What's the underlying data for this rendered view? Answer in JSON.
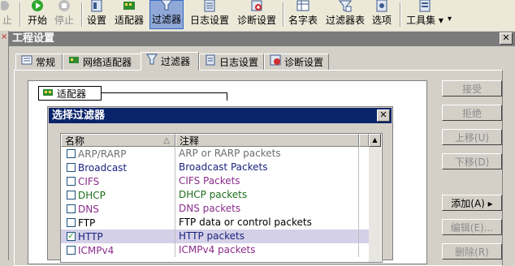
{
  "toolbar": {
    "buttons": [
      {
        "label": "止",
        "icon": "stop-icon",
        "disabled": true
      },
      {
        "label": "开始",
        "icon": "play-icon",
        "disabled": false
      },
      {
        "label": "停止",
        "icon": "stop-icon",
        "disabled": true
      },
      {
        "label": "设置",
        "icon": "settings-icon",
        "disabled": false
      },
      {
        "label": "适配器",
        "icon": "adapter-icon",
        "disabled": false
      },
      {
        "label": "过滤器",
        "icon": "filter-icon",
        "disabled": false,
        "active": true
      },
      {
        "label": "日志设置",
        "icon": "log-icon",
        "disabled": false
      },
      {
        "label": "诊断设置",
        "icon": "diagnose-icon",
        "disabled": false
      },
      {
        "label": "名字表",
        "icon": "name-table-icon",
        "disabled": false
      },
      {
        "label": "过滤器表",
        "icon": "filter-table-icon",
        "disabled": false
      },
      {
        "label": "选项",
        "icon": "options-icon",
        "disabled": false
      },
      {
        "label": "工具集",
        "icon": "toolset-icon",
        "disabled": false
      }
    ],
    "toolset_arrow": "▾"
  },
  "project_window": {
    "title": "工程设置",
    "close_label": "✕",
    "tabs": [
      {
        "label": "常规",
        "icon": "general-icon"
      },
      {
        "label": "网络适配器",
        "icon": "adapter-icon"
      },
      {
        "label": "过滤器",
        "icon": "filter-icon",
        "active": true
      },
      {
        "label": "日志设置",
        "icon": "log-icon"
      },
      {
        "label": "诊断设置",
        "icon": "diagnose-icon"
      }
    ],
    "adapter_node_label": "适配器",
    "side_buttons": [
      {
        "label": "接受",
        "enabled": false
      },
      {
        "label": "拒绝",
        "enabled": false
      },
      {
        "label": "上移(U)",
        "enabled": false
      },
      {
        "label": "下移(D)",
        "enabled": false
      },
      {
        "label": "添加(A) ▸",
        "enabled": true
      },
      {
        "label": "编辑(E)...",
        "enabled": false
      },
      {
        "label": "删除(R)",
        "enabled": false
      }
    ]
  },
  "dialog": {
    "title": "选择过滤器",
    "close_label": "✕",
    "columns": [
      "名称",
      "注释"
    ],
    "sort_indicator": "△",
    "rows": [
      {
        "name": "ARP/RARP",
        "comment": "ARP or RARP packets",
        "checked": false,
        "color": "#6e6e6e"
      },
      {
        "name": "Broadcast",
        "comment": "Broadcast Packets",
        "checked": false,
        "color": "#1a237e"
      },
      {
        "name": "CIFS",
        "comment": "CIFS Packets",
        "checked": false,
        "color": "#8b2d8b"
      },
      {
        "name": "DHCP",
        "comment": "DHCP packets",
        "checked": false,
        "color": "#1b6e1b"
      },
      {
        "name": "DNS",
        "comment": "DNS packets",
        "checked": false,
        "color": "#8b2d8b"
      },
      {
        "name": "FTP",
        "comment": "FTP data or control packets",
        "checked": false,
        "color": "#000000"
      },
      {
        "name": "HTTP",
        "comment": "HTTP  packets",
        "checked": true,
        "color": "#1a237e"
      },
      {
        "name": "ICMPv4",
        "comment": "ICMPv4 packets",
        "checked": false,
        "color": "#8b2d8b"
      }
    ]
  },
  "colors": {
    "dialog_title_bg": "#0a246a",
    "project_title_bg": "#7b7b7b",
    "selected_row": "#d4d0e8",
    "toolbar_active": "#8fa8d8"
  }
}
